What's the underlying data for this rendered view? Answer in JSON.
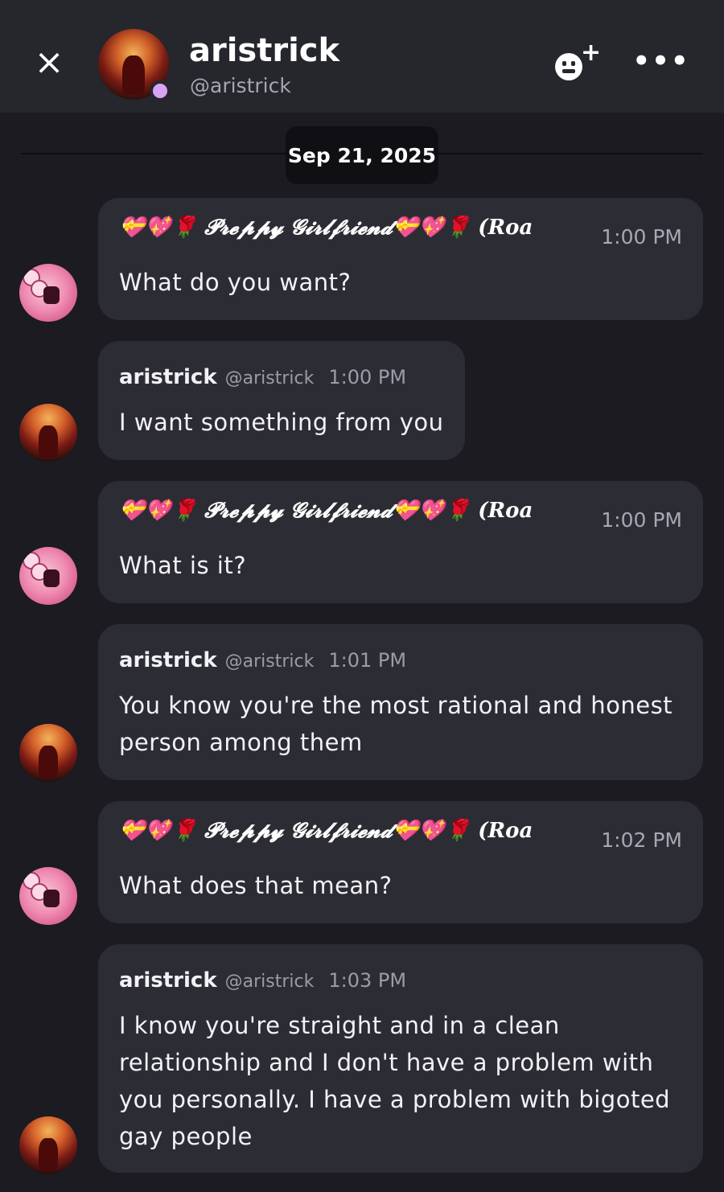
{
  "header": {
    "close_icon": "×",
    "name": "aristrick",
    "handle": "@aristrick",
    "status_color": "#d9a3f5",
    "more_icon": "•••",
    "add_friend_icon": "add-friend-icon"
  },
  "date_divider": "Sep 21, 2025",
  "colors": {
    "background": "#1b1b21",
    "header": "#26262d",
    "bubble": "#2c2c34",
    "text": "#f2f2f6",
    "muted": "#9c9ca8"
  },
  "messages": [
    {
      "sender": "💝💖🌹 𝓟𝓻𝓮𝓹𝓹𝔂 𝓖𝓲𝓻𝓵𝓯𝓻𝓲𝓮𝓷𝓭💝💖🌹 (Roa",
      "time": "1:00 PM",
      "lines": [
        "What do you want?"
      ]
    },
    {
      "sender": "aristrick",
      "handle": "@aristrick",
      "time": "1:00 PM",
      "lines": [
        "I want something from you"
      ]
    },
    {
      "sender": "💝💖🌹 𝓟𝓻𝓮𝓹𝓹𝔂 𝓖𝓲𝓻𝓵𝓯𝓻𝓲𝓮𝓷𝓭💝💖🌹 (Roa",
      "time": "1:00 PM",
      "lines": [
        "What is it?"
      ]
    },
    {
      "sender": "aristrick",
      "handle": "@aristrick",
      "time": "1:01 PM",
      "lines": [
        "You know you're the most rational and honest",
        "person among them"
      ]
    },
    {
      "sender": "💝💖🌹 𝓟𝓻𝓮𝓹𝓹𝔂 𝓖𝓲𝓻𝓵𝓯𝓻𝓲𝓮𝓷𝓭💝💖🌹 (Roa",
      "time": "1:02 PM",
      "lines": [
        "What does that mean?"
      ]
    },
    {
      "sender": "aristrick",
      "handle": "@aristrick",
      "time": "1:03 PM",
      "lines": [
        "I know you're straight and in a clean",
        "relationship and I don't have a problem with",
        "you personally. I have a problem with bigoted",
        "gay people"
      ]
    }
  ]
}
